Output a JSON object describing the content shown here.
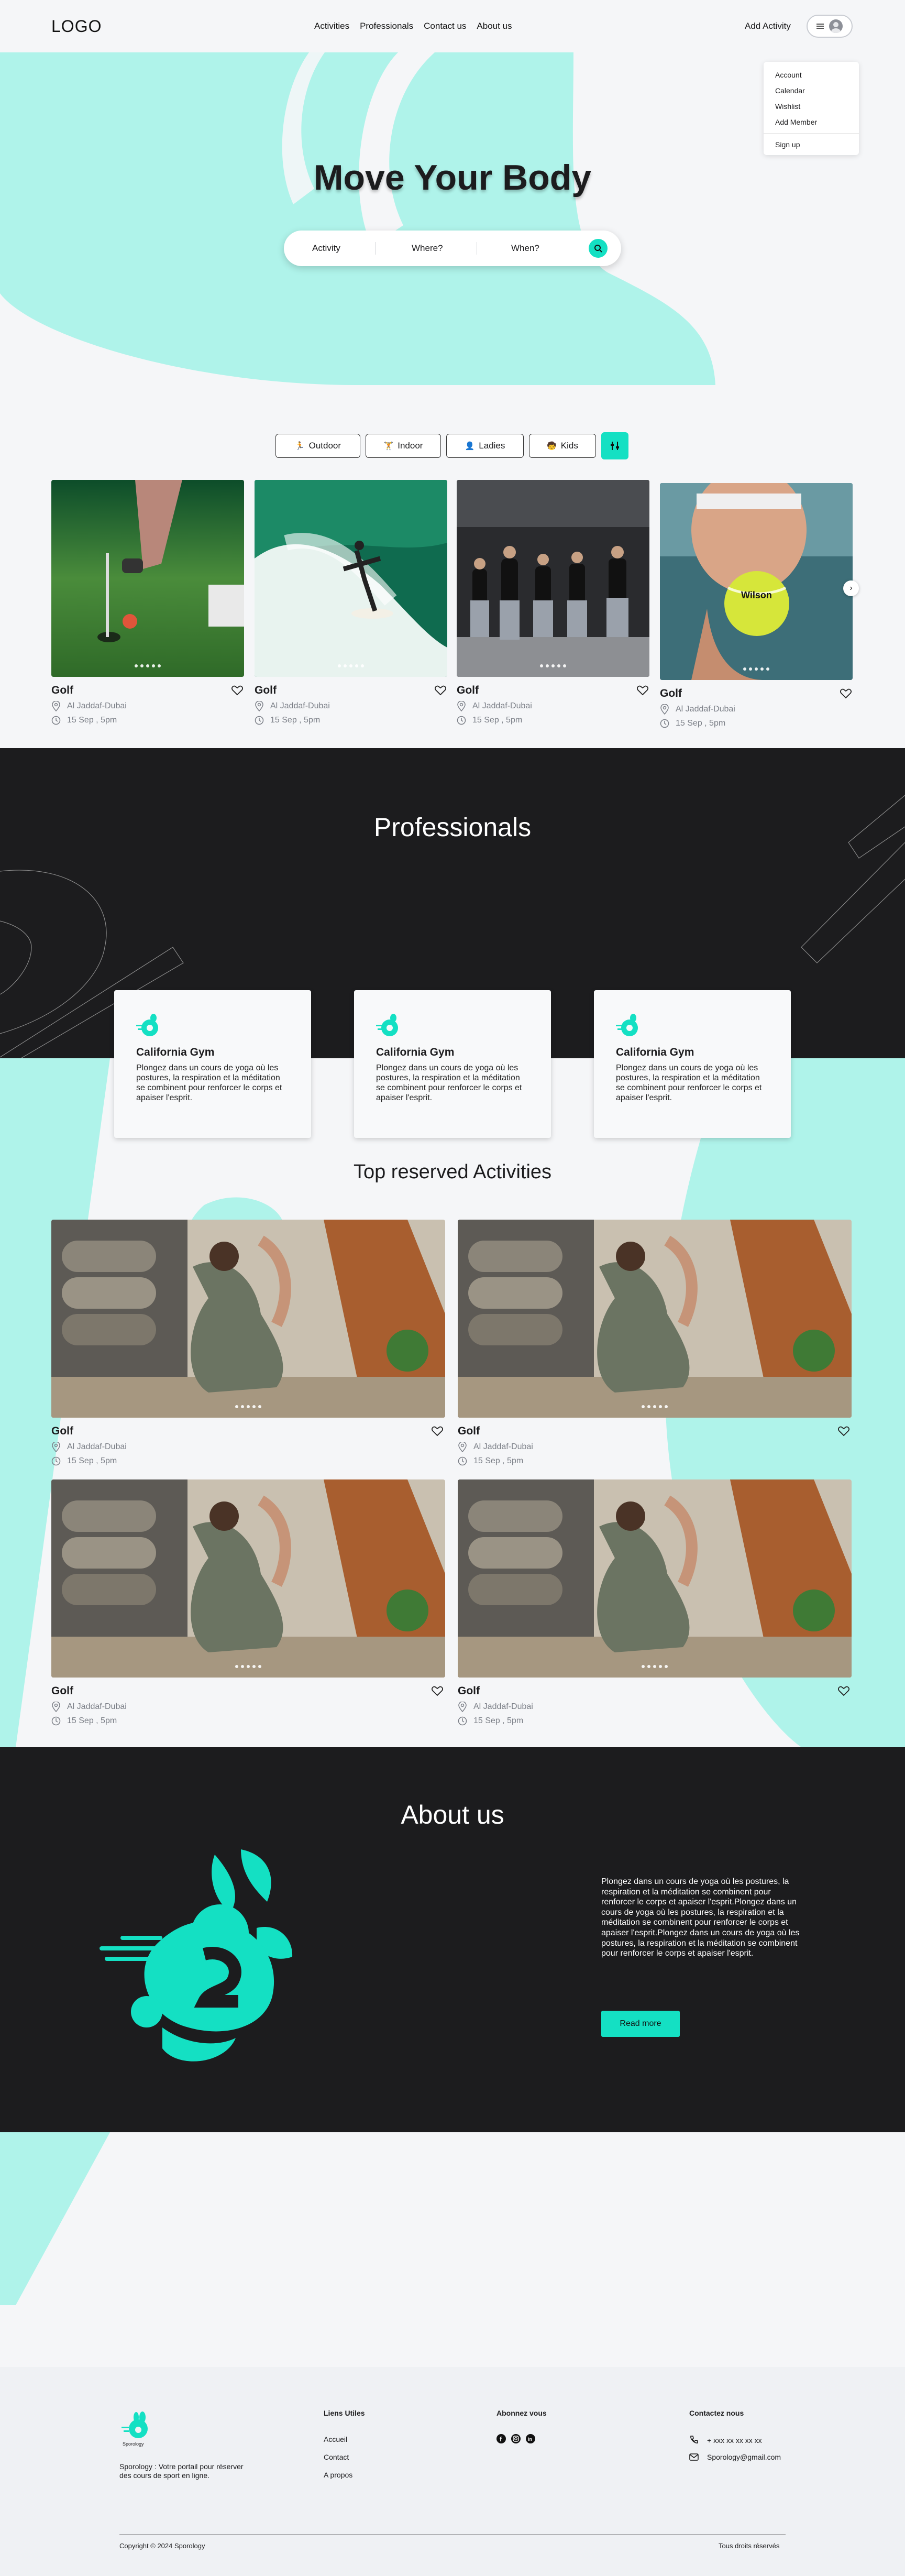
{
  "header": {
    "logo": "LOGO",
    "nav": [
      "Activities",
      "Professionals",
      "Contact us",
      "About us"
    ],
    "add_activity": "Add Activity"
  },
  "dropdown": {
    "items": [
      "Account",
      "Calendar",
      "Wishlist",
      "Add Member",
      "Sign up"
    ]
  },
  "hero": {
    "title": "Move Your Body",
    "search": {
      "activity": "Activity",
      "where": "Where?",
      "when": "When?"
    }
  },
  "filters": [
    "Outdoor",
    "Indoor",
    "Ladies",
    "Kids"
  ],
  "activities": [
    {
      "title": "Golf",
      "location": "Al Jaddaf-Dubai",
      "date": "15 Sep , 5pm"
    },
    {
      "title": "Golf",
      "location": "Al Jaddaf-Dubai",
      "date": "15 Sep , 5pm"
    },
    {
      "title": "Golf",
      "location": "Al Jaddaf-Dubai",
      "date": "15 Sep , 5pm"
    },
    {
      "title": "Golf",
      "location": "Al Jaddaf-Dubai",
      "date": "15 Sep , 5pm"
    }
  ],
  "professionals": {
    "title": "Professionals",
    "cards": [
      {
        "name": "California Gym",
        "desc": "Plongez dans un cours de yoga où les postures, la respiration et la méditation se combinent pour renforcer le corps et apaiser l'esprit."
      },
      {
        "name": "California Gym",
        "desc": "Plongez dans un cours de yoga où les postures, la respiration et la méditation se combinent pour renforcer le corps et apaiser l'esprit."
      },
      {
        "name": "California Gym",
        "desc": "Plongez dans un cours de yoga où les postures, la respiration et la méditation se combinent pour renforcer le corps et apaiser l'esprit."
      }
    ]
  },
  "top": {
    "title": "Top reserved  Activities",
    "cards": [
      {
        "title": "Golf",
        "location": "Al Jaddaf-Dubai",
        "date": "15 Sep , 5pm"
      },
      {
        "title": "Golf",
        "location": "Al Jaddaf-Dubai",
        "date": "15 Sep , 5pm"
      },
      {
        "title": "Golf",
        "location": "Al Jaddaf-Dubai",
        "date": "15 Sep , 5pm"
      },
      {
        "title": "Golf",
        "location": "Al Jaddaf-Dubai",
        "date": "15 Sep , 5pm"
      }
    ]
  },
  "about": {
    "title": "About us",
    "text": "Plongez dans un cours de yoga où les postures, la respiration et la méditation se combinent pour renforcer le corps et apaiser l'esprit.Plongez dans un cours de yoga où les postures, la respiration et la méditation se combinent pour renforcer le corps et apaiser l'esprit.Plongez dans un cours de yoga où les postures, la respiration et la méditation se combinent pour renforcer le corps et apaiser l'esprit.",
    "button": "Read more"
  },
  "footer": {
    "brand": "Sporology",
    "tagline": "Sporology : Votre portail pour réserver des cours de sport en ligne.",
    "links_title": "Liens Utiles",
    "links": [
      "Accueil",
      "Contact",
      "A propos"
    ],
    "follow_title": "Abonnez vous",
    "contact_title": "Contactez nous",
    "phone": "+ xxx xx xx xx xx",
    "email": "Sporology@gmail.com",
    "copyright": "Copyright © 2024 Sporology",
    "rights": "Tous droits réservés"
  },
  "colors": {
    "accent": "#14e0c3",
    "mint": "#aff3ea",
    "dark": "#1c1c1e"
  }
}
